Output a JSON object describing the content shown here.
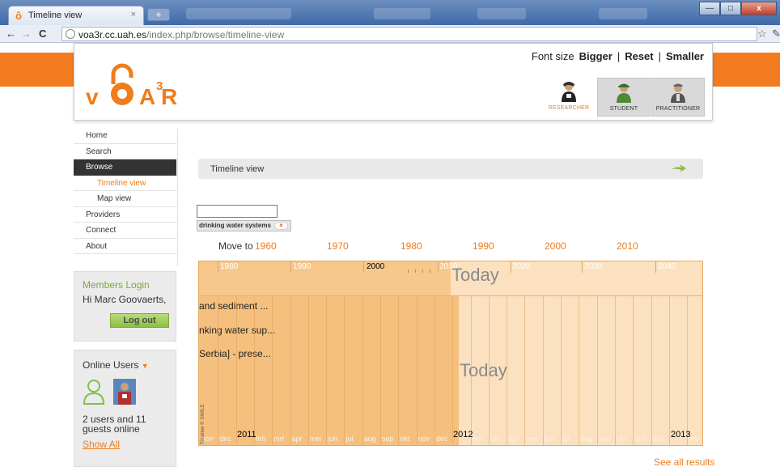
{
  "browser": {
    "tab_title": "Timeline view",
    "tab_close": "×",
    "new_tab": "+",
    "url_host": "voa3r.cc.uah.es",
    "url_path": "/index.php/browse/timeline-view",
    "back": "←",
    "forward": "→",
    "reload": "C",
    "star": "☆",
    "wrench": "🔧",
    "minimize": "—",
    "maximize": "□",
    "close": "x"
  },
  "header": {
    "logo_v": "v",
    "logo_ar": "A R",
    "logo_sup": "3",
    "font_size_label": "Font size",
    "bigger": "Bigger",
    "reset": "Reset",
    "smaller": "Smaller",
    "separator": "|",
    "roles": [
      {
        "label": "RESEARCHER",
        "active": true
      },
      {
        "label": "STUDENT",
        "active": false
      },
      {
        "label": "PRACTITIONER",
        "active": false
      }
    ]
  },
  "sidebar": {
    "items": [
      {
        "label": "Home"
      },
      {
        "label": "Search"
      },
      {
        "label": "Browse"
      },
      {
        "label": "Timeline view"
      },
      {
        "label": "Map view"
      },
      {
        "label": "Providers"
      },
      {
        "label": "Connect"
      },
      {
        "label": "About"
      }
    ]
  },
  "login": {
    "title": "Members Login",
    "greeting": "Hi Marc Goovaerts,",
    "logout": "Log out"
  },
  "online": {
    "title": "Online Users",
    "caret": "▼",
    "count": "2 users and 11 guests online",
    "show_all": "Show All"
  },
  "main": {
    "breadcrumb": "Timeline view",
    "search_value": "",
    "filter_tag": "drinking water systems",
    "filter_remove": "×",
    "move_to": "Move to",
    "decades": [
      "1960",
      "1970",
      "1980",
      "1990",
      "2000",
      "2010"
    ],
    "see_all": "See all results"
  },
  "timeline": {
    "top_decades": [
      "1980",
      "1990",
      "2000",
      "2010",
      "2020",
      "2030",
      "2040"
    ],
    "today_top": "Today",
    "today_bottom": "Today",
    "events": [
      "and sediment ...",
      "nking water sup...",
      "Serbia] - prese..."
    ],
    "months": [
      "nov",
      "dec",
      "jan",
      "feb",
      "mrt",
      "apr",
      "mei",
      "jun",
      "jul",
      "aug",
      "sep",
      "okt",
      "nov",
      "dec",
      "jan",
      "feb",
      "mrt",
      "apr",
      "mei",
      "jun",
      "jul",
      "aug",
      "sep",
      "okt",
      "nov",
      "dec",
      "jan",
      "feb"
    ],
    "years": [
      "2011",
      "2012",
      "2013"
    ],
    "copyright": "Timeline © SIMILE"
  },
  "colors": {
    "accent": "#f07c1b",
    "green": "#7ea83a",
    "timeline_past": "#f5c07e",
    "timeline_future": "#fbe1c0"
  }
}
